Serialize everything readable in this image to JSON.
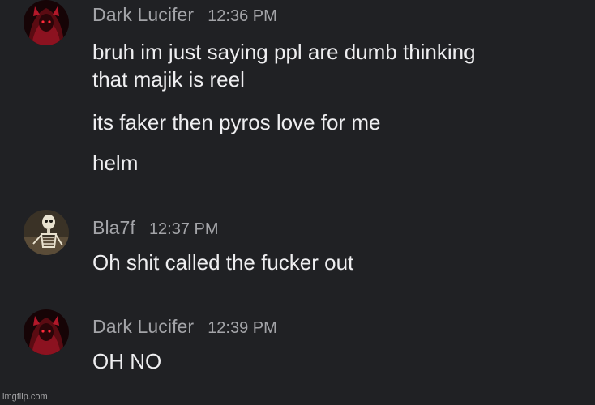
{
  "messages": [
    {
      "username": "Dark Lucifer",
      "time": "12:36 PM",
      "avatar_icon": "dark-red-anime-avatar-icon",
      "lines": [
        "bruh im just saying ppl are dumb thinking",
        "that majik is reel",
        "its faker then pyros love for me",
        "helm"
      ]
    },
    {
      "username": "Bla7f",
      "time": "12:37 PM",
      "avatar_icon": "skeleton-avatar-icon",
      "lines": [
        "Oh shit called the fucker out"
      ]
    },
    {
      "username": "Dark Lucifer",
      "time": "12:39 PM",
      "avatar_icon": "dark-red-anime-avatar-icon",
      "lines": [
        "OH NO"
      ]
    }
  ],
  "watermark": "imgflip.com",
  "colors": {
    "background": "#202124",
    "username": "#a3a4a8",
    "message_text": "#eeeef0"
  }
}
